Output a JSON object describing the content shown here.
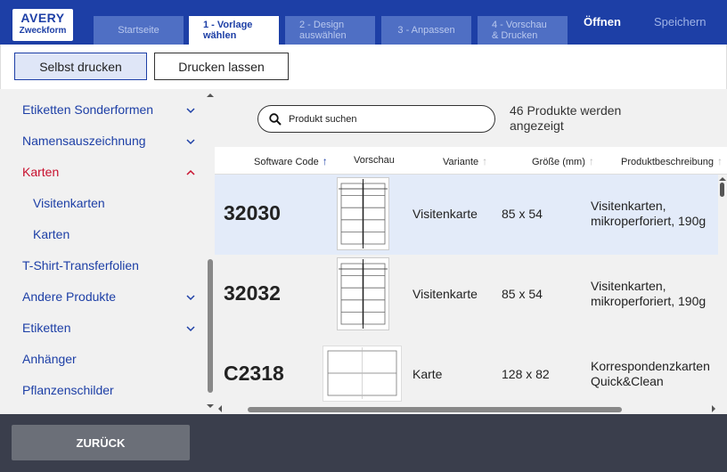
{
  "header": {
    "logo_line1": "AVERY",
    "logo_line2": "Zweckform",
    "tabs": [
      {
        "label": "Startseite"
      },
      {
        "label": "1 - Vorlage\nwählen"
      },
      {
        "label": "2 - Design\nauswählen"
      },
      {
        "label": "3 - Anpassen"
      },
      {
        "label": "4 - Vorschau\n& Drucken"
      }
    ],
    "open_label": "Öffnen",
    "save_label": "Speichern"
  },
  "print_modes": {
    "self_print": "Selbst drucken",
    "print_service": "Drucken lassen"
  },
  "sidebar": {
    "items": [
      {
        "label": "Etiketten Sonderformen",
        "chevron": "down"
      },
      {
        "label": "Namensauszeichnung",
        "chevron": "down"
      },
      {
        "label": "Karten",
        "chevron": "up"
      },
      {
        "label": "Visitenkarten"
      },
      {
        "label": "Karten"
      },
      {
        "label": "T-Shirt-Transferfolien"
      },
      {
        "label": "Andere Produkte",
        "chevron": "down"
      },
      {
        "label": "Etiketten",
        "chevron": "down"
      },
      {
        "label": "Anhänger"
      },
      {
        "label": "Pflanzenschilder"
      }
    ]
  },
  "search": {
    "placeholder": "Produkt suchen",
    "value": ""
  },
  "result_count": "46 Produkte werden angezeigt",
  "table": {
    "columns": {
      "code": "Software Code",
      "preview": "Vorschau",
      "variant": "Variante",
      "size": "Größe (mm)",
      "description": "Produktbeschreibung"
    },
    "rows": [
      {
        "code": "32030",
        "variant": "Visitenkarte",
        "size": "85 x 54",
        "description": "Visitenkarten, mikroperforiert, 190g"
      },
      {
        "code": "32032",
        "variant": "Visitenkarte",
        "size": "85 x 54",
        "description": "Visitenkarten, mikroperforiert, 190g"
      },
      {
        "code": "C2318",
        "variant": "Karte",
        "size": "128 x 82",
        "description": "Korrespondenzkarten Quick&Clean"
      }
    ]
  },
  "footer": {
    "back_label": "ZURÜCK"
  },
  "colors": {
    "brand_blue": "#1d3fa6",
    "active_red": "#c8102e",
    "footer_bg": "#3a3e4c"
  }
}
